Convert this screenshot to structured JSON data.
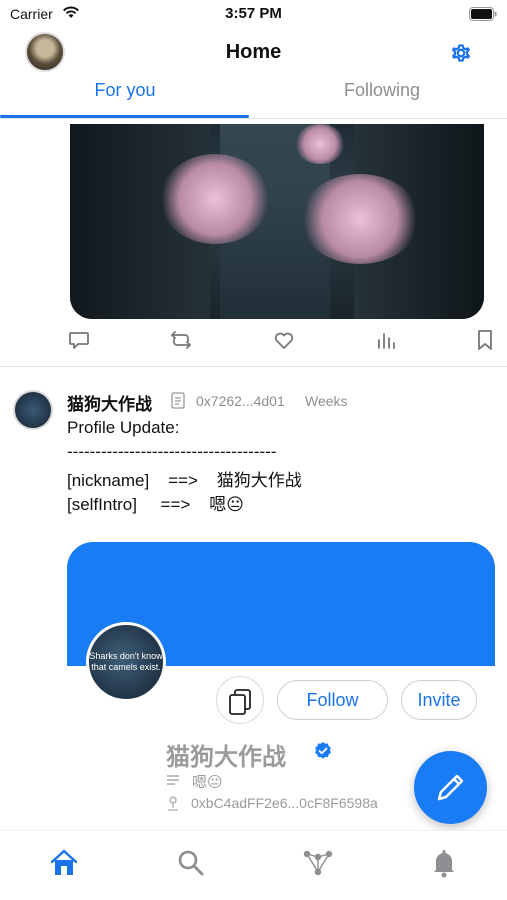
{
  "status_bar": {
    "carrier": "Carrier",
    "time": "3:57 PM"
  },
  "header": {
    "title": "Home"
  },
  "tabs": [
    {
      "label": "For you",
      "selected": true
    },
    {
      "label": "Following",
      "selected": false
    }
  ],
  "feed": {
    "post1": {
      "image_alt": "cherry blossom street at night",
      "actions": [
        "comment-icon",
        "repost-icon",
        "like-icon",
        "stats-icon",
        "bookmark-icon"
      ]
    },
    "post2": {
      "author": "猫狗大作战",
      "address": "0x7262...4d01",
      "time": "Weeks",
      "lines": [
        "Profile Update:",
        "-------------------------------------",
        "[nickname]    ==>    猫狗大作战",
        "[selfIntro]     ==>    嗯😐"
      ],
      "profile_card": {
        "avatar_text": "Sharks don't know that camels exist.",
        "follow_label": "Follow",
        "invite_label": "Invite",
        "name": "猫狗大作战",
        "bio": "嗯😐",
        "address": "0xbC4adFF2e6...0cF8F6598a"
      }
    }
  },
  "colors": {
    "accent": "#1a73e8",
    "banner": "#1a7cf5",
    "muted": "#8e8e93"
  },
  "bottom_nav": [
    "home-icon",
    "search-icon",
    "network-icon",
    "bell-icon"
  ]
}
